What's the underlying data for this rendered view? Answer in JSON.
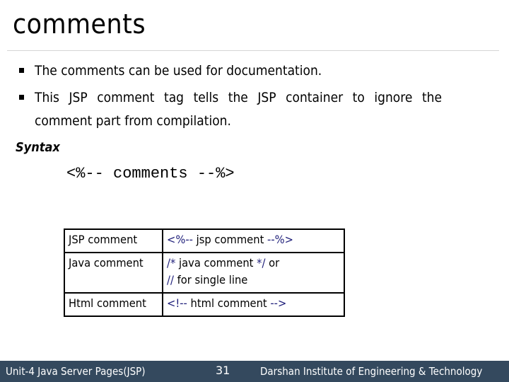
{
  "slide": {
    "title": "comments",
    "bullets": [
      "The comments can be used for documentation.",
      "This JSP comment tag tells the JSP container to ignore the",
      "comment part from compilation."
    ],
    "syntax_label": "Syntax",
    "syntax_code": "<%-- comments --%>"
  },
  "table": {
    "rows": [
      {
        "label": "JSP comment",
        "open": "<%--",
        "text": " jsp comment ",
        "close": "--%>"
      },
      {
        "label": "Java comment",
        "open": "/*",
        "text": " java comment ",
        "close": "*/",
        "suffix": " or",
        "line2_open": "//",
        "line2_text": " for single line"
      },
      {
        "label": "Html comment",
        "open": "<!--",
        "text": " html comment ",
        "close": "-->"
      }
    ]
  },
  "footer": {
    "unit": "Unit-4 Java Server Pages(JSP)",
    "page_number": "31",
    "institute": "Darshan Institute of Engineering & Technology",
    "background_color": "#34495e",
    "marker_color": "#1f1f7a"
  }
}
